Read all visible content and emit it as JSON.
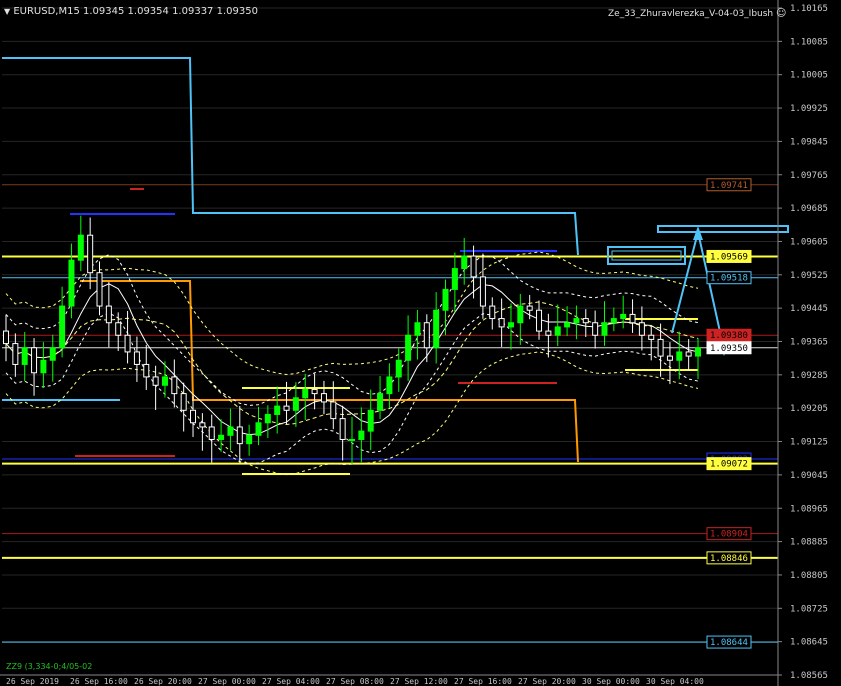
{
  "header": {
    "symbol_info": "EURUSD,M15  1.09345 1.09354 1.09337 1.09350",
    "indicator_name": "Ze_33_Zhuravlerezka_V-04-03_Ibush",
    "footer_text": "ZZ9 (3,334-0;4/05-02"
  },
  "colors": {
    "background": "#000000",
    "grid": "#262626",
    "text": "#c8c8c8",
    "bull_candle": "#00ff00",
    "bear_candle": "#ffffff",
    "price_line": "#ffffff",
    "cyan": "#4fc3f7",
    "yellow": "#ffff40",
    "orange": "#ff9900",
    "red": "#cc2222",
    "blue": "#2233ff",
    "brown": "#8b4513"
  },
  "chart_data": {
    "type": "candlestick",
    "ylim": [
      1.08565,
      1.10165
    ],
    "y_ticks": [
      "1.10165",
      "1.10085",
      "1.10005",
      "1.09925",
      "1.09845",
      "1.09765",
      "1.09685",
      "1.09605",
      "1.09525",
      "1.09445",
      "1.09365",
      "1.09285",
      "1.09205",
      "1.09125",
      "1.09045",
      "1.08965",
      "1.08885",
      "1.08805",
      "1.08725",
      "1.08645",
      "1.08565"
    ],
    "x_ticks": [
      "26 Sep 2019",
      "26 Sep 16:00",
      "26 Sep 20:00",
      "27 Sep 00:00",
      "27 Sep 04:00",
      "27 Sep 08:00",
      "27 Sep 12:00",
      "27 Sep 16:00",
      "27 Sep 20:00",
      "30 Sep 00:00",
      "30 Sep 04:00"
    ],
    "current_price": 1.0935,
    "price_labels": [
      {
        "text": "1.10165",
        "value": 1.10165,
        "color": "#c8c8c8",
        "boxed": false
      },
      {
        "text": "1.09741",
        "value": 1.09741,
        "color": "#b35c2e",
        "boxed": true
      },
      {
        "text": "1.09569",
        "value": 1.09569,
        "color": "#ffff40",
        "boxed": true
      },
      {
        "text": "1.09518",
        "value": 1.09518,
        "color": "#4fc3f7",
        "boxed": true
      },
      {
        "text": "1.09380",
        "value": 1.0938,
        "color": "#cc2222",
        "boxed": true
      },
      {
        "text": "1.09350",
        "value": 1.0935,
        "color": "#ffffff",
        "boxed": true
      },
      {
        "text": "1.09083",
        "value": 1.09083,
        "color": "#2233ff",
        "boxed": true
      },
      {
        "text": "1.09072",
        "value": 1.09072,
        "color": "#ffff40",
        "boxed": true
      },
      {
        "text": "1.08904",
        "value": 1.08904,
        "color": "#cc2222",
        "boxed": true
      },
      {
        "text": "1.08846",
        "value": 1.08846,
        "color": "#ffff40",
        "boxed": true
      },
      {
        "text": "1.08644",
        "value": 1.08644,
        "color": "#4fc3f7",
        "boxed": true
      }
    ],
    "horizontal_levels": [
      {
        "value": 1.09741,
        "color": "#7a3a1a",
        "name": "level-1.09741"
      },
      {
        "value": 1.09569,
        "color": "#ffff40",
        "name": "level-1.09569"
      },
      {
        "value": 1.09518,
        "color": "#4fc3f7",
        "name": "level-1.09518"
      },
      {
        "value": 1.0938,
        "color": "#aa1a1a",
        "name": "level-1.09380"
      },
      {
        "value": 1.0935,
        "color": "#dddddd",
        "name": "level-1.09350"
      },
      {
        "value": 1.09083,
        "color": "#2233ff",
        "name": "level-1.09083"
      },
      {
        "value": 1.09072,
        "color": "#ffff40",
        "name": "level-1.09072"
      },
      {
        "value": 1.08904,
        "color": "#aa1a1a",
        "name": "level-1.08904"
      },
      {
        "value": 1.08846,
        "color": "#ffff40",
        "name": "level-1.08846"
      },
      {
        "value": 1.08644,
        "color": "#4fc3f7",
        "name": "level-1.08644"
      }
    ],
    "close_path": [
      1.0936,
      1.0931,
      1.0935,
      1.0929,
      1.0932,
      1.0935,
      1.0945,
      1.0956,
      1.0962,
      1.0953,
      1.0945,
      1.0941,
      1.0938,
      1.0934,
      1.0931,
      1.0928,
      1.0926,
      1.0928,
      1.0924,
      1.092,
      1.0917,
      1.0916,
      1.0913,
      1.0914,
      1.0916,
      1.0912,
      1.0914,
      1.0917,
      1.0919,
      1.0921,
      1.092,
      1.0923,
      1.0925,
      1.0924,
      1.0922,
      1.0918,
      1.0913,
      1.0913,
      1.0915,
      1.092,
      1.0924,
      1.0928,
      1.0932,
      1.0938,
      1.0941,
      1.0935,
      1.0944,
      1.0949,
      1.0954,
      1.0957,
      1.0952,
      1.0945,
      1.0942,
      1.094,
      1.0941,
      1.0945,
      1.0944,
      1.0939,
      1.0938,
      1.094,
      1.0941,
      1.0942,
      1.0941,
      1.0938,
      1.0941,
      1.0942,
      1.0943,
      1.0941,
      1.0938,
      1.0937,
      1.0933,
      1.0932,
      1.0934,
      1.0933,
      1.0935
    ]
  }
}
